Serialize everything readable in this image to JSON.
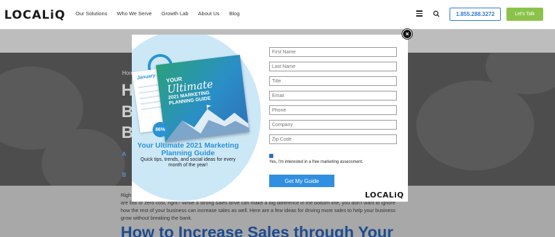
{
  "header": {
    "logo": "LOCALiQ",
    "nav": [
      "Our Solutions",
      "Who We Serve",
      "Growth Lab",
      "About Us",
      "Blog"
    ],
    "phone": "1.855.288.3272",
    "cta": "Let's Talk"
  },
  "hero": {
    "breadcrumb": "Hom",
    "letters": [
      "H",
      "B",
      "B"
    ],
    "byline_fragments": [
      "A",
      "B"
    ]
  },
  "article": {
    "intro_start": "Righ",
    "intro_line2": "are low or zero cost, right? While a strong sales drive can make a big difference in the bottom line, you don't want to ignore",
    "intro_line3": "how the rest of your business can increase sales as well. Here are a few ideas for driving more sales to help your business",
    "intro_line4": "grow without breaking the bank.",
    "heading": "How to Increase Sales through Your"
  },
  "modal": {
    "close_symbol": "×",
    "book": {
      "back_cover": "January 2021",
      "kicker": "YOUR",
      "script_title": "Ultimate",
      "subtitle_line1": "2021 MARKETING",
      "subtitle_line2": "PLANNING GUIDE",
      "badge": "86%"
    },
    "promo_title": "Your Ultimate 2021 Marketing Planning Guide",
    "promo_subtitle": "Quick tips, trends, and social ideas for every month of the year!",
    "fields": [
      "First Name",
      "Last Name",
      "Title",
      "Email",
      "Phone",
      "Company",
      "Zip Code"
    ],
    "checkbox_label": "Yes, I'm interested in a free marketing assessment.",
    "checkbox_checked": true,
    "submit_label": "Get My Guide",
    "logo": "LOCALiQ"
  },
  "colors": {
    "brand_blue": "#2a93d5",
    "cta_green": "#8bc34a",
    "submit_blue": "#2f8fe0"
  }
}
